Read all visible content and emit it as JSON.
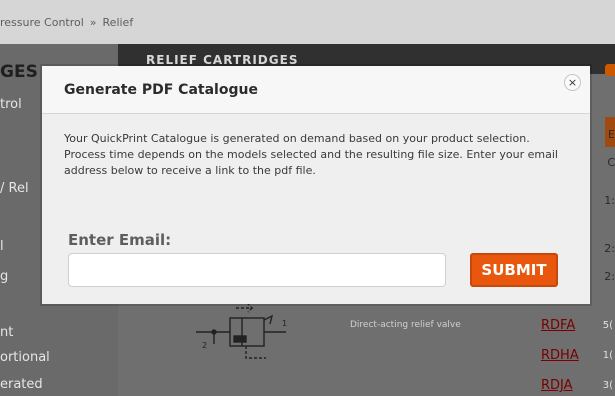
{
  "breadcrumb": {
    "items": [
      "ressure Control",
      "»",
      "Relief"
    ]
  },
  "sidebar": {
    "title": "GES",
    "items": [
      "trol",
      "/ Rel",
      "l",
      "g",
      "nt",
      "ortional",
      "erated"
    ]
  },
  "main": {
    "header_title": "RELIEF CARTRIDGES",
    "right_fragments": [
      "E",
      "C",
      "1:",
      "2:",
      "2:",
      "5(",
      "1(",
      "3("
    ],
    "row_description": "Direct-acting relief valve",
    "codes": [
      "RDFA",
      "RDHA",
      "RDJA"
    ],
    "schematic_labels": [
      "1",
      "2"
    ]
  },
  "dialog": {
    "title": "Generate PDF Catalogue",
    "close_symbol": "×",
    "body_text": "Your QuickPrint Catalogue is generated on demand based on your product selection. Process time depends on the models selected and the resulting file size. Enter your email address below to receive a link to the pdf file.",
    "email_label": "Enter Email:",
    "email_value": "",
    "email_placeholder": "",
    "submit_label": "SUBMIT"
  },
  "colors": {
    "overlay": "#7b7b7b",
    "accent": "#e8570d",
    "link": "#7a0000"
  }
}
